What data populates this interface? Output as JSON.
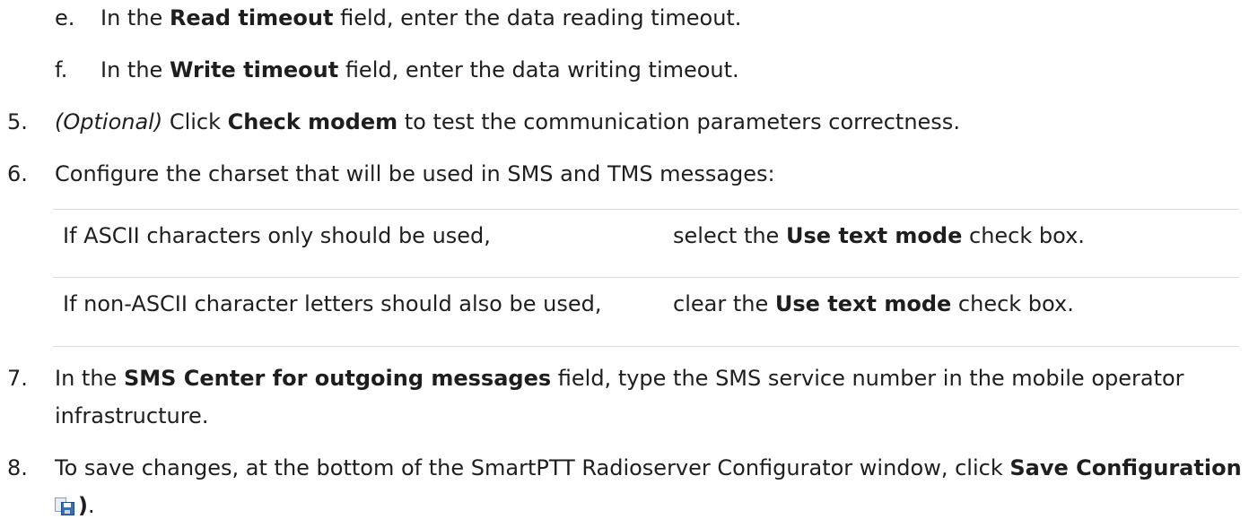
{
  "sub_steps": [
    {
      "marker": "e.",
      "pre": "In the ",
      "bold": "Read timeout",
      "post": " field, enter the data reading timeout."
    },
    {
      "marker": "f.",
      "pre": "In the ",
      "bold": "Write timeout",
      "post": " field, enter the data writing timeout."
    }
  ],
  "step5": {
    "marker": "5.",
    "italic": "(Optional)",
    "pre": " Click ",
    "bold": "Check modem",
    "post": " to test the communication parameters correctness."
  },
  "step6": {
    "marker": "6.",
    "text": "Configure the charset that will be used in SMS and TMS messages:"
  },
  "table": {
    "rows": [
      {
        "condition": "If ASCII characters only should be used,",
        "action_pre": "select the ",
        "action_bold": "Use text mode",
        "action_post": " check box."
      },
      {
        "condition": "If non-ASCII character letters should also be used,",
        "action_pre": "clear the ",
        "action_bold": "Use text mode",
        "action_post": " check box."
      }
    ]
  },
  "step7": {
    "marker": "7.",
    "pre": "In the ",
    "bold": "SMS Center for outgoing messages",
    "post": " field, type the SMS service number in the mobile operator",
    "cont": "infrastructure."
  },
  "step8": {
    "marker": "8.",
    "pre": "To save changes, at the bottom of the SmartPTT Radioserver Configurator window, click ",
    "bold": "Save Configuration (",
    "icon": "save-configuration-icon",
    "bold_end": ")",
    "end": "."
  }
}
